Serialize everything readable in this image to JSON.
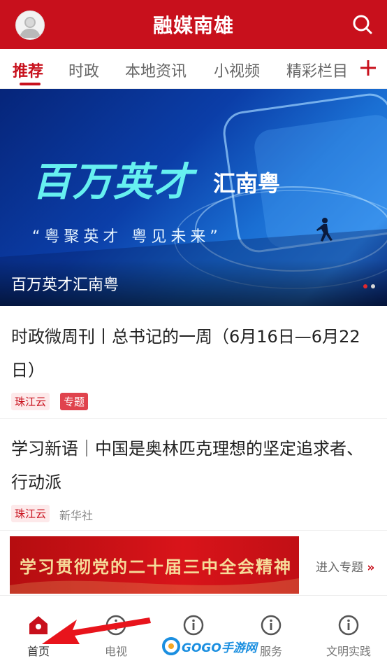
{
  "header": {
    "title": "融媒南雄",
    "colors": {
      "brand": "#c8101c"
    }
  },
  "tabs": [
    {
      "label": "推荐",
      "active": true
    },
    {
      "label": "时政",
      "active": false
    },
    {
      "label": "本地资讯",
      "active": false
    },
    {
      "label": "小视频",
      "active": false
    },
    {
      "label": "精彩栏目",
      "active": false
    }
  ],
  "banner": {
    "headline": "百万英才",
    "subheadline": "汇南粤",
    "quote": "“粤聚英才 粤见未来”",
    "caption": "百万英才汇南粤",
    "page_count": 2,
    "active_page": 1
  },
  "articles": [
    {
      "title": "时政微周刊丨总书记的一周（6月16日—6月22日）",
      "source": "珠江云",
      "badge": "专题"
    },
    {
      "title": "学习新语｜中国是奥林匹克理想的坚定追求者、行动派",
      "source": "珠江云",
      "publisher": "新华社"
    }
  ],
  "promo": {
    "image_text": "学习贯彻党的二十届三中全会精神",
    "link_label": "进入专题",
    "chevron": "»"
  },
  "bottom_nav": [
    {
      "label": "首页",
      "icon": "home-icon",
      "active": true
    },
    {
      "label": "电视",
      "icon": "info-icon",
      "active": false
    },
    {
      "label": "",
      "icon": "info-icon",
      "active": false
    },
    {
      "label": "服务",
      "icon": "info-icon",
      "active": false
    },
    {
      "label": "文明实践",
      "icon": "info-icon",
      "active": false
    }
  ],
  "watermark": {
    "text": "GOGO手游网"
  }
}
